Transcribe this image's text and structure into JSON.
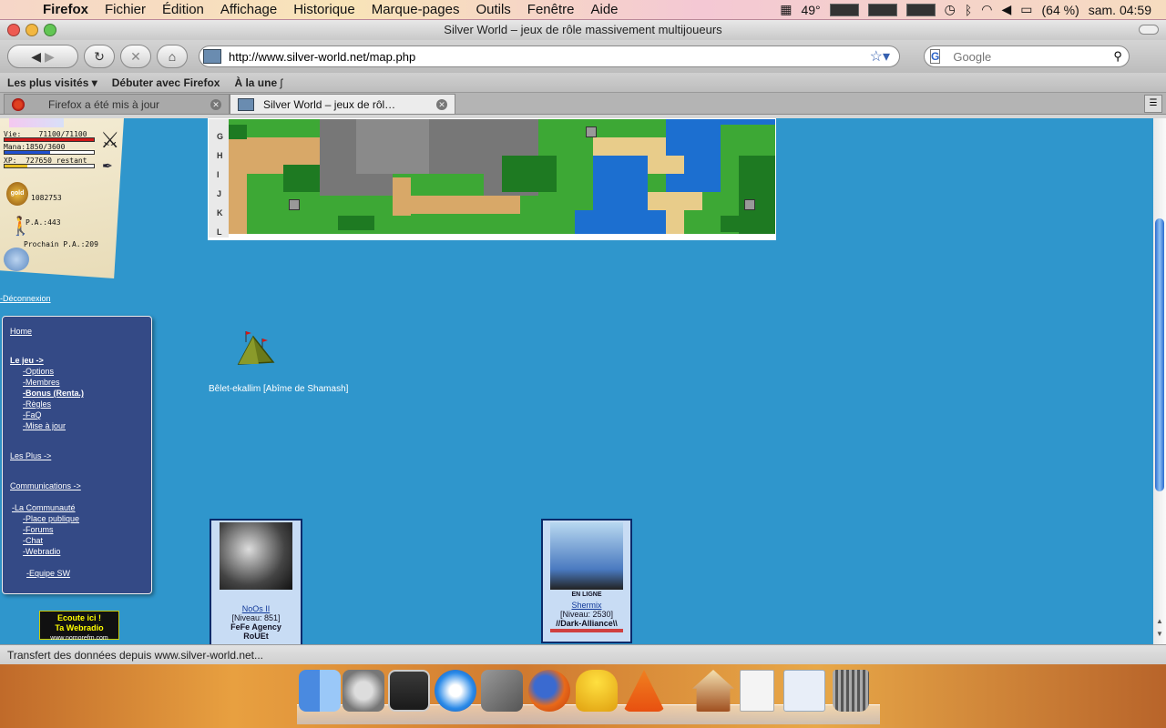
{
  "menubar": {
    "app": "Firefox",
    "items": [
      "Fichier",
      "Édition",
      "Affichage",
      "Historique",
      "Marque-pages",
      "Outils",
      "Fenêtre",
      "Aide"
    ],
    "temperature": "49°",
    "battery": "(64 %)",
    "clock": "sam. 04:59"
  },
  "window": {
    "title": "Silver World – jeux de rôle massivement multijoueurs"
  },
  "navbar": {
    "url": "http://www.silver-world.net/map.php",
    "search_placeholder": "Google"
  },
  "bookmarks": {
    "items": [
      "Les plus visités ▾",
      "Débuter avec Firefox",
      "À la une"
    ]
  },
  "tabs": [
    {
      "label": "Firefox a été mis à jour",
      "active": false
    },
    {
      "label": "Silver World – jeux de rôl…",
      "active": true
    }
  ],
  "status": {
    "text": "Transfert des données depuis www.silver-world.net..."
  },
  "player_panel": {
    "vie_label": "Vie:",
    "vie_value": "71100/71100",
    "vie_fraction": 1.0,
    "mana_label": "Mana:",
    "mana_value": "1850/3600",
    "mana_fraction": 0.51,
    "xp_label": "XP:",
    "xp_value": "727650 restant",
    "xp_fraction": 0.25,
    "gold": "1082753",
    "pa": "P.A.:443",
    "prochain_pa": "Prochain P.A.:209",
    "deconnexion": "-Déconnexion"
  },
  "side_menu": {
    "home": "Home",
    "le_jeu": "Le jeu ->",
    "jeu_items": [
      "-Options",
      "-Membres",
      "-Bonus (Renta.)",
      "-Règles",
      "-FaQ",
      "-Mise à jour"
    ],
    "les_plus": "Les Plus ->",
    "communications": "Communications ->",
    "communaute": "-La Communauté",
    "comm_items": [
      "-Place publique",
      "-Forums",
      "-Chat",
      "-Webradio"
    ],
    "equipe": "-Equipe SW"
  },
  "webradio_banner": {
    "line1": "Ecoute ici !",
    "line2": "Ta Webradio",
    "line3": "www.nomorefm.com"
  },
  "map": {
    "rows": [
      "G",
      "H",
      "I",
      "J",
      "K",
      "L"
    ]
  },
  "location": {
    "label": "Bêlet-ekallim [Abîme de Shamash]"
  },
  "players": [
    {
      "name": "NoOs II",
      "level": "[Niveau: 851]",
      "group": "FeFe Agency",
      "extra": "RoUEt",
      "online": ""
    },
    {
      "name": "Shermix",
      "level": "[Niveau: 2530]",
      "group": "//Dark-Alliance\\\\",
      "extra": "",
      "online": "EN LIGNE"
    }
  ],
  "colors": {
    "page_bg": "#2f96cc",
    "menu_bg": "#344a86",
    "grass": "#3da835",
    "water": "#1c6fd0",
    "rock": "#6c6c6c",
    "sand": "#e8cc8a"
  }
}
